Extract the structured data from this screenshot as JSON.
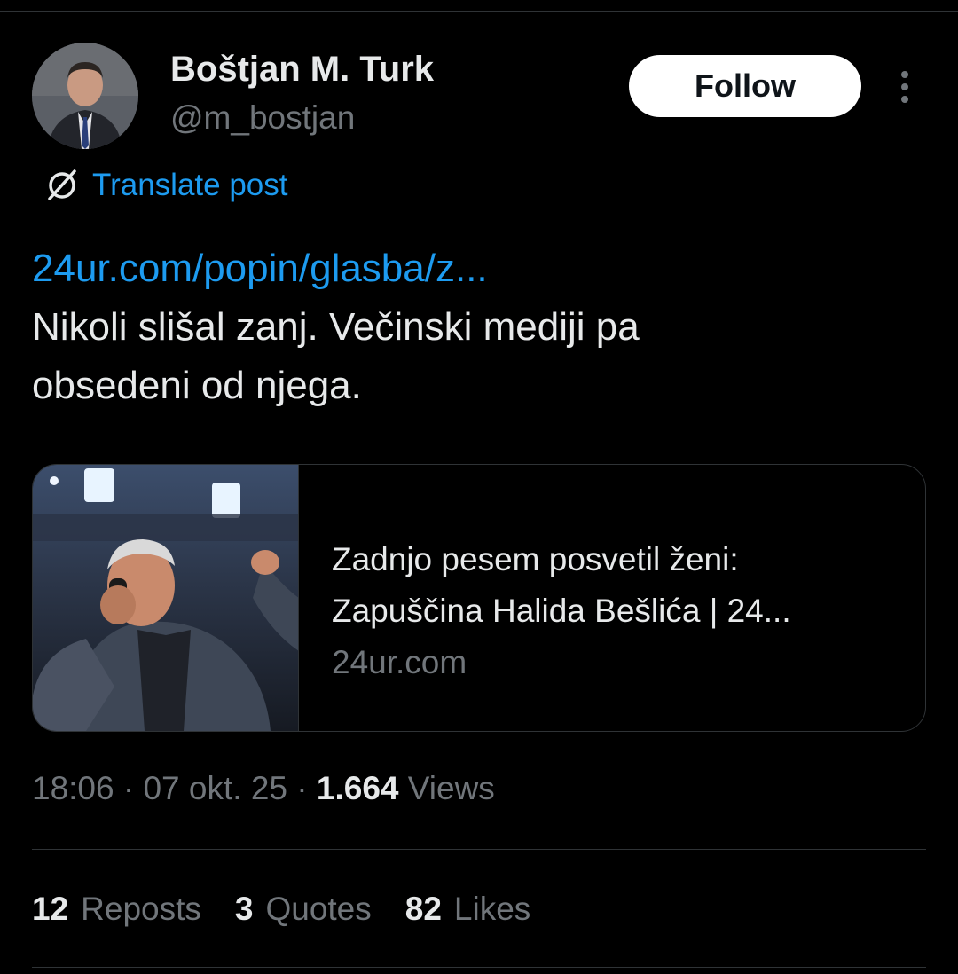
{
  "author": {
    "display_name": "Boštjan M. Turk",
    "handle": "@m_bostjan",
    "avatar": "author-avatar-photo"
  },
  "follow_button": {
    "label": "Follow"
  },
  "more_menu": {
    "icon": "more-vertical-icon"
  },
  "translate": {
    "label": "Translate post",
    "icon": "translate-globe-icon",
    "color": "#1d9bf0"
  },
  "post": {
    "link_text": "24ur.com/popin/glasba/z...",
    "lines": [
      "Nikoli slišal zanj. Večinski mediji pa",
      "obsedeni od njega."
    ]
  },
  "link_card": {
    "title_lines": [
      "Zadnjo pesem posvetil ženi:",
      "Zapuščina Halida Bešlića | 24..."
    ],
    "domain": "24ur.com",
    "thumbnail": "singer-on-stage-photo"
  },
  "meta": {
    "time": "18:06",
    "separator": "·",
    "date": "07 okt. 25",
    "views_count": "1.664",
    "views_label": "Views"
  },
  "stats": {
    "reposts_count": "12",
    "reposts_label": "Reposts",
    "quotes_count": "3",
    "quotes_label": "Quotes",
    "likes_count": "82",
    "likes_label": "Likes"
  },
  "colors": {
    "background": "#000000",
    "text_primary": "#e7e9ea",
    "text_secondary": "#71767b",
    "link": "#1d9bf0",
    "divider": "#2f3336"
  }
}
